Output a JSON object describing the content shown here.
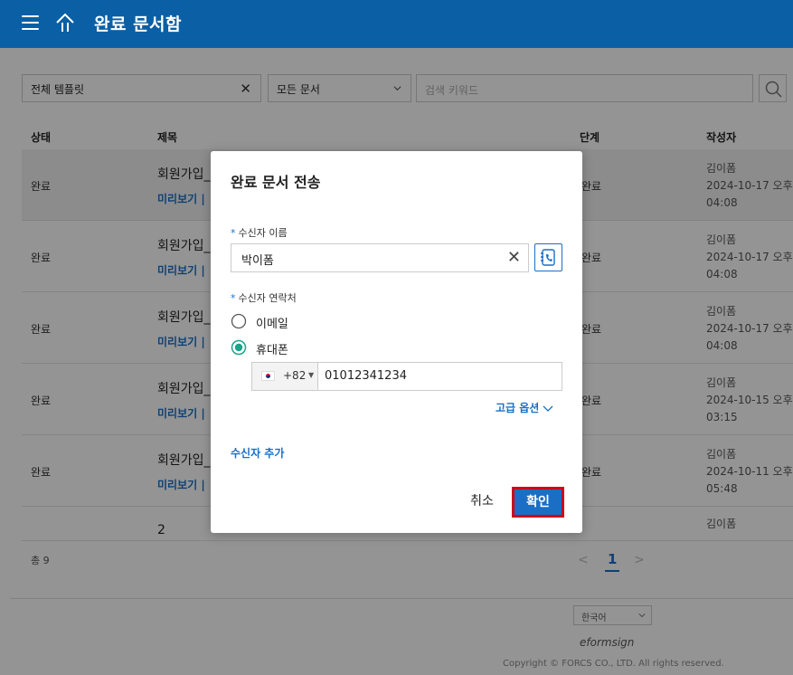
{
  "header": {
    "title": "완료 문서함",
    "menu_icon": "hamburger-icon",
    "home_icon": "home-icon"
  },
  "filters": {
    "template_select": "전체 템플릿",
    "doc_select": "모든 문서",
    "search_placeholder": "검색 키워드"
  },
  "table": {
    "columns": {
      "status": "상태",
      "title": "제목",
      "stage": "단계",
      "author": "작성자"
    },
    "rows": [
      {
        "status": "완료",
        "title": "회원가입_",
        "preview": "미리보기 |",
        "stage": "완료",
        "author": "김이폼",
        "date": "2024-10-17 오후",
        "time": "04:08"
      },
      {
        "status": "완료",
        "title": "회원가입_",
        "preview": "미리보기 |",
        "stage": "완료",
        "author": "김이폼",
        "date": "2024-10-17 오후",
        "time": "04:08"
      },
      {
        "status": "완료",
        "title": "회원가입_",
        "preview": "미리보기 |",
        "stage": "완료",
        "author": "김이폼",
        "date": "2024-10-17 오후",
        "time": "04:08"
      },
      {
        "status": "완료",
        "title": "회원가입_",
        "preview": "미리보기 |",
        "stage": "완료",
        "author": "김이폼",
        "date": "2024-10-15 오후",
        "time": "03:15"
      },
      {
        "status": "완료",
        "title": "회원가입_",
        "preview": "미리보기 |",
        "stage": "완료",
        "author": "김이폼",
        "date": "2024-10-11 오후",
        "time": "05:48"
      },
      {
        "status": "",
        "title": "2",
        "preview": "",
        "stage": "",
        "author": "김이폼",
        "date": "",
        "time": ""
      }
    ]
  },
  "footer": {
    "total": "총 9",
    "pager": {
      "prev": "<",
      "current": "1",
      "next": ">"
    },
    "language": "한국어",
    "brand": "eformsign",
    "copyright": "Copyright © FORCS CO., LTD. All rights reserved."
  },
  "modal": {
    "title": "완료 문서 전송",
    "name_label": "수신자 이름",
    "name_value": "박이폼",
    "contact_label": "수신자 연락처",
    "option_email": "이메일",
    "option_phone": "휴대폰",
    "selected_option": "휴대폰",
    "country_code": "+82",
    "phone_number": "01012341234",
    "advanced_options": "고급 옵션",
    "add_recipient": "수신자 추가",
    "cancel": "취소",
    "confirm": "확인",
    "accent_color": "#1a6fc4",
    "highlight_color": "#d0021b"
  },
  "colors": {
    "topbar": "#0b5fa5",
    "link": "#1a6fc4"
  }
}
